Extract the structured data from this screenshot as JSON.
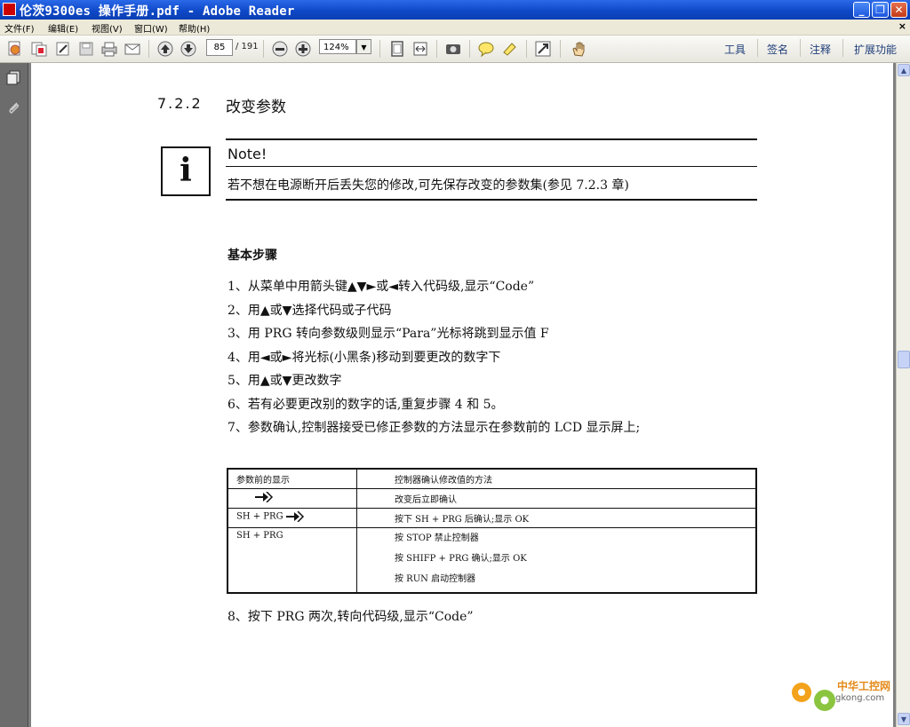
{
  "window": {
    "title": "伦茨9300es 操作手册.pdf - Adobe Reader"
  },
  "menu": {
    "items": [
      "文件(F)",
      "编辑(E)",
      "视图(V)",
      "窗口(W)",
      "帮助(H)"
    ],
    "close": "×"
  },
  "toolbar": {
    "page_current": "85",
    "page_total": "/ 191",
    "zoom": "124%",
    "right_items": [
      "工具",
      "签名",
      "注释",
      "扩展功能"
    ]
  },
  "document": {
    "section_number": "7.2.2",
    "section_title": "改变参数",
    "note": {
      "icon_text": "i",
      "label": "Note!",
      "text": "若不想在电源断开后丢失您的修改,可先保存改变的参数集(参见 7.2.3 章)"
    },
    "steps_title": "基本步骤",
    "steps": [
      "1、从菜单中用箭头键▲▼►或◄转入代码级,显示“Code”",
      "2、用▲或▼选择代码或子代码",
      "3、用 PRG 转向参数级则显示“Para”光标将跳到显示值 F",
      "4、用◄或►将光标(小黑条)移动到要更改的数字下",
      "5、用▲或▼更改数字",
      "6、若有必要更改别的数字的话,重复步骤 4 和 5。",
      "7、参数确认,控制器接受已修正参数的方法显示在参数前的 LCD 显示屏上;"
    ],
    "table": {
      "header": [
        "参数前的显示",
        "控制器确认修改值的方法"
      ],
      "rows": [
        {
          "display": "",
          "methods": [
            "改变后立即确认"
          ]
        },
        {
          "display": "SH + PRG",
          "methods": [
            "按下 SH + PRG 后确认;显示 OK"
          ]
        },
        {
          "display": "SH + PRG",
          "methods": [
            "按 STOP 禁止控制器",
            "按 SHIFP + PRG 确认;显示 OK",
            "按 RUN 启动控制器"
          ]
        }
      ]
    },
    "final_step": "8、按下 PRG 两次,转向代码级,显示“Code”"
  },
  "watermark": {
    "line1": "中华工控网",
    "line2": "gkong.com"
  }
}
